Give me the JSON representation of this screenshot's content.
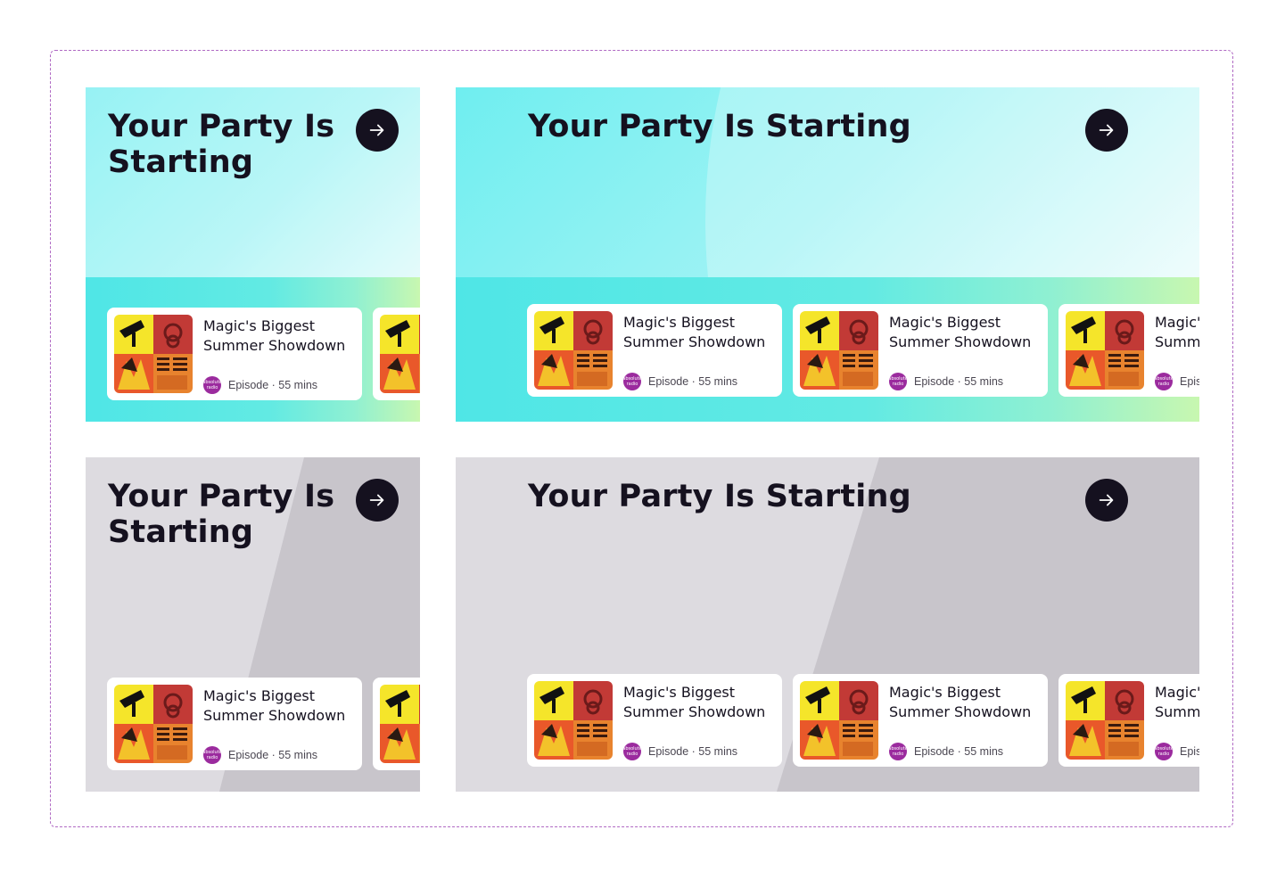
{
  "panel_title": "Your Party Is Starting",
  "panel_title_line1": "Your Party Is",
  "panel_title_line2": "Starting",
  "arrow_icon": "arrow-right-icon",
  "episode": {
    "title_line1": "Magic's Biggest",
    "title_line2": "Summer Showdown",
    "meta": "Episode · 55 mins",
    "badge_text": "absolute radio"
  },
  "colors": {
    "teal": "#6feef0",
    "grey": "#dddbe0",
    "grey_shape": "#c8c5cb",
    "dark": "#15111f",
    "badge": "#9b2b9e",
    "frame_border": "#b06ac4"
  }
}
